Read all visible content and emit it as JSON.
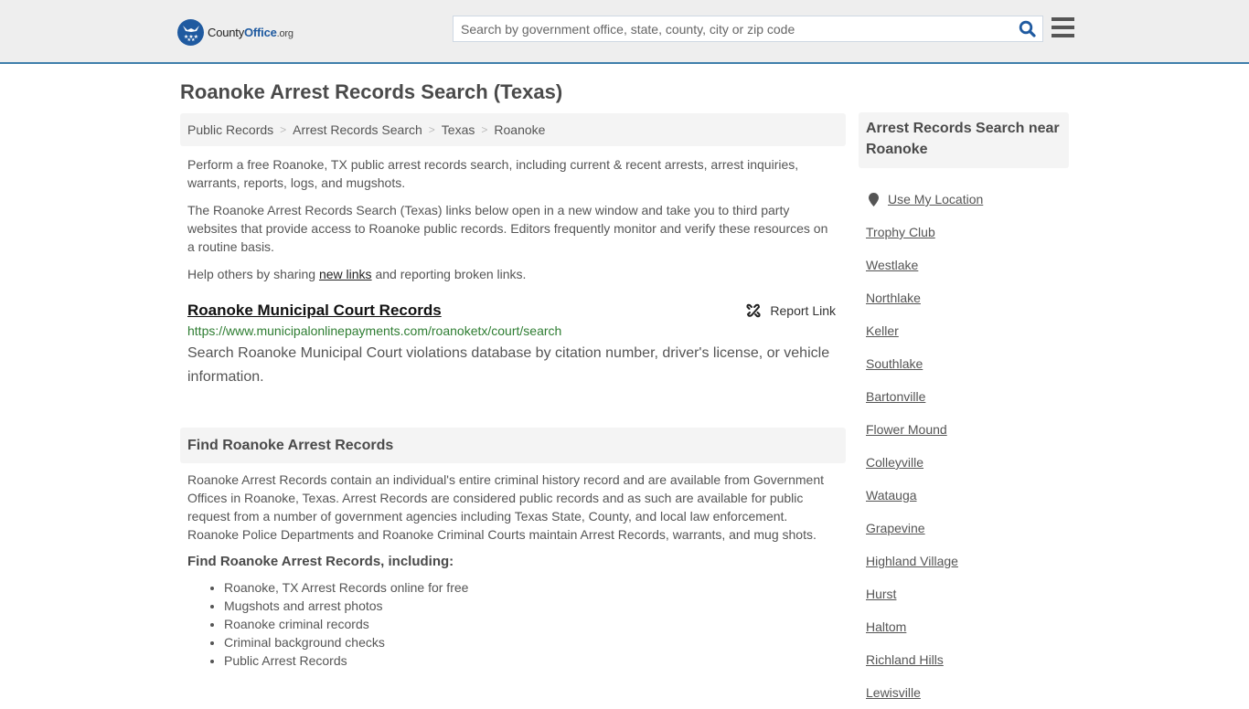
{
  "header": {
    "logo": {
      "name_part1": "County",
      "name_part2": "Office",
      "suffix": ".org",
      "icon": "eagle-stars-badge-icon"
    },
    "search": {
      "placeholder": "Search by government office, state, county, city or zip code",
      "value": "",
      "icon": "search-icon"
    },
    "menu_icon": "hamburger-menu-icon"
  },
  "page_title": "Roanoke Arrest Records Search (Texas)",
  "breadcrumb": [
    {
      "label": "Public Records"
    },
    {
      "label": "Arrest Records Search"
    },
    {
      "label": "Texas"
    },
    {
      "label": "Roanoke"
    }
  ],
  "intro": {
    "p1": "Perform a free Roanoke, TX public arrest records search, including current & recent arrests, arrest inquiries, warrants, reports, logs, and mugshots.",
    "p2": "The Roanoke Arrest Records Search (Texas) links below open in a new window and take you to third party websites that provide access to Roanoke public records. Editors frequently monitor and verify these resources on a routine basis.",
    "p3_before": "Help others by sharing ",
    "p3_link": "new links",
    "p3_after": " and reporting broken links."
  },
  "results": [
    {
      "title": "Roanoke Municipal Court Records",
      "url": "https://www.municipalonlinepayments.com/roanoketx/court/search",
      "description": "Search Roanoke Municipal Court violations database by citation number, driver's license, or vehicle information.",
      "report_label": "Report Link",
      "report_icon": "broken-link-icon"
    }
  ],
  "find_section": {
    "heading": "Find Roanoke Arrest Records",
    "paragraph": "Roanoke Arrest Records contain an individual's entire criminal history record and are available from Government Offices in Roanoke, Texas. Arrest Records are considered public records and as such are available for public request from a number of government agencies including Texas State, County, and local law enforcement. Roanoke Police Departments and Roanoke Criminal Courts maintain Arrest Records, warrants, and mug shots.",
    "subheading": "Find Roanoke Arrest Records, including:",
    "items": [
      "Roanoke, TX Arrest Records online for free",
      "Mugshots and arrest photos",
      "Roanoke criminal records",
      "Criminal background checks",
      "Public Arrest Records"
    ]
  },
  "sidebar": {
    "heading": "Arrest Records Search near Roanoke",
    "use_location": "Use My Location",
    "location_icon": "map-marker-icon",
    "nearby": [
      "Trophy Club",
      "Westlake",
      "Northlake",
      "Keller",
      "Southlake",
      "Bartonville",
      "Flower Mound",
      "Colleyville",
      "Watauga",
      "Grapevine",
      "Highland Village",
      "Hurst",
      "Haltom",
      "Richland Hills",
      "Lewisville"
    ]
  },
  "colors": {
    "brand_blue": "#1f5aa0",
    "header_border": "#3f7eab",
    "url_green": "#2e7d32",
    "panel_bg": "#f4f4f4"
  }
}
